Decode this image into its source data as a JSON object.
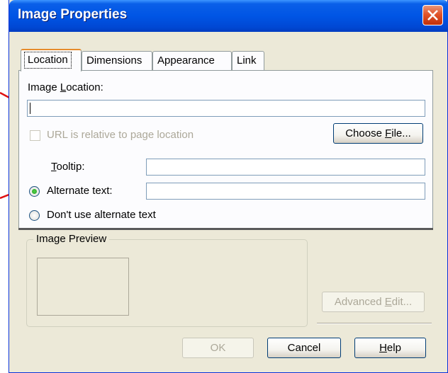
{
  "window": {
    "title": "Image Properties"
  },
  "tabs": [
    {
      "label": "Location",
      "active": true
    },
    {
      "label": "Dimensions",
      "active": false
    },
    {
      "label": "Appearance",
      "active": false
    },
    {
      "label": "Link",
      "active": false
    }
  ],
  "location": {
    "image_location_label": {
      "pre": "Image ",
      "key": "L",
      "post": "ocation:"
    },
    "image_location_value": "",
    "relative_checkbox": {
      "label": "URL is relative to page location",
      "checked": false,
      "enabled": false
    },
    "choose_file": {
      "pre": "Choose ",
      "key": "F",
      "post": "ile..."
    },
    "tooltip_label": {
      "pre": "",
      "key": "T",
      "post": "ooltip:"
    },
    "tooltip_value": "",
    "alt_text_radio": {
      "label": "Alternate text:",
      "selected": true
    },
    "alt_text_value": "",
    "no_alt_radio": {
      "label": "Don't use alternate text",
      "selected": false
    }
  },
  "preview": {
    "title": "Image Preview"
  },
  "advanced_edit": {
    "pre": "Advanced ",
    "key": "E",
    "post": "dit..."
  },
  "buttons": {
    "ok": "OK",
    "cancel": "Cancel",
    "help": {
      "pre": "",
      "key": "H",
      "post": "elp"
    }
  },
  "colors": {
    "title_bar": "#0055e5",
    "dialog_bg": "#ece9d8",
    "annotation_arrow": "#e01010",
    "active_tab_accent": "#e68b2c"
  }
}
